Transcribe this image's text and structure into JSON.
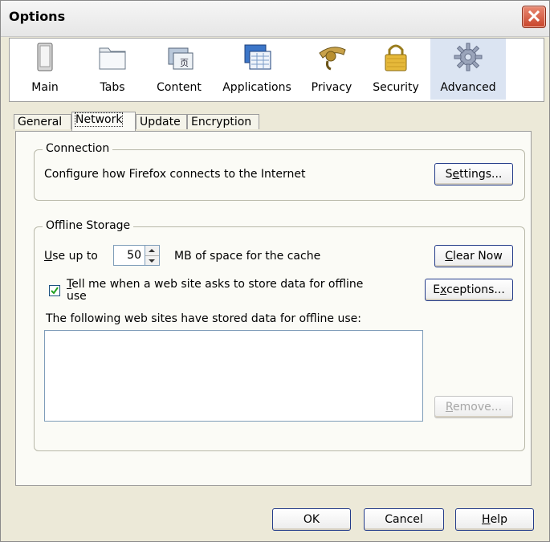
{
  "window": {
    "title": "Options"
  },
  "panes": [
    {
      "label": "Main",
      "icon": "main-pane-icon"
    },
    {
      "label": "Tabs",
      "icon": "tabs-pane-icon"
    },
    {
      "label": "Content",
      "icon": "content-pane-icon"
    },
    {
      "label": "Applications",
      "icon": "applications-pane-icon"
    },
    {
      "label": "Privacy",
      "icon": "privacy-pane-icon"
    },
    {
      "label": "Security",
      "icon": "security-pane-icon"
    },
    {
      "label": "Advanced",
      "icon": "advanced-pane-icon",
      "selected": true
    }
  ],
  "subtabs": [
    {
      "label": "General"
    },
    {
      "label": "Network",
      "active": true
    },
    {
      "label": "Update"
    },
    {
      "label": "Encryption"
    }
  ],
  "connection": {
    "group_label": "Connection",
    "description": "Configure how Firefox connects to the Internet",
    "settings_button": {
      "prefix": "S",
      "accel": "e",
      "suffix": "ttings..."
    }
  },
  "offline": {
    "group_label": "Offline Storage",
    "use_up_to": {
      "accel": "U",
      "suffix": "se up to"
    },
    "cache_value": "50",
    "cache_suffix": "MB of space for the cache",
    "clear_now_button": {
      "accel": "C",
      "suffix": "lear Now"
    },
    "tell_me": {
      "accel": "T",
      "line1_suffix": "ell me when a web site asks to store data for offline",
      "line2": "use",
      "checked": true
    },
    "exceptions_button": {
      "prefix": "E",
      "accel": "x",
      "suffix": "ceptions..."
    },
    "stored_label": "The following web sites have stored data for offline use:",
    "stored_sites": [],
    "remove_button": {
      "accel": "R",
      "suffix": "emove..."
    }
  },
  "footer": {
    "ok": "OK",
    "cancel": "Cancel",
    "help": {
      "accel": "H",
      "suffix": "elp"
    }
  }
}
